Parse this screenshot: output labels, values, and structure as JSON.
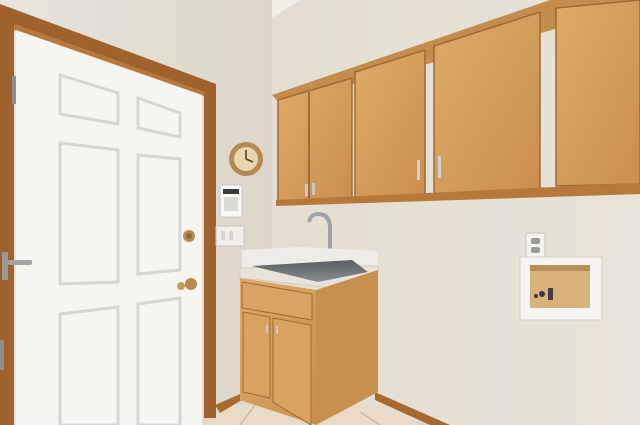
{
  "scene": {
    "description_label": "",
    "colors": {
      "wall_left": "#e6e1d6",
      "wall_right": "#e2ddd1",
      "ceiling": "#efece6",
      "door": "#f5f4f1",
      "door_trim": "#a0622c",
      "cabinet_wood": "#d59f5e",
      "cabinet_dark": "#b77c3e",
      "countertop": "#e9e6df",
      "floor_tile": "#e8d7c2",
      "baseboard": "#a8692f"
    },
    "icons": [
      "wall-clock-icon",
      "alarm-keypad-icon",
      "outlet-icon",
      "faucet-icon",
      "door-knob-icon"
    ]
  }
}
